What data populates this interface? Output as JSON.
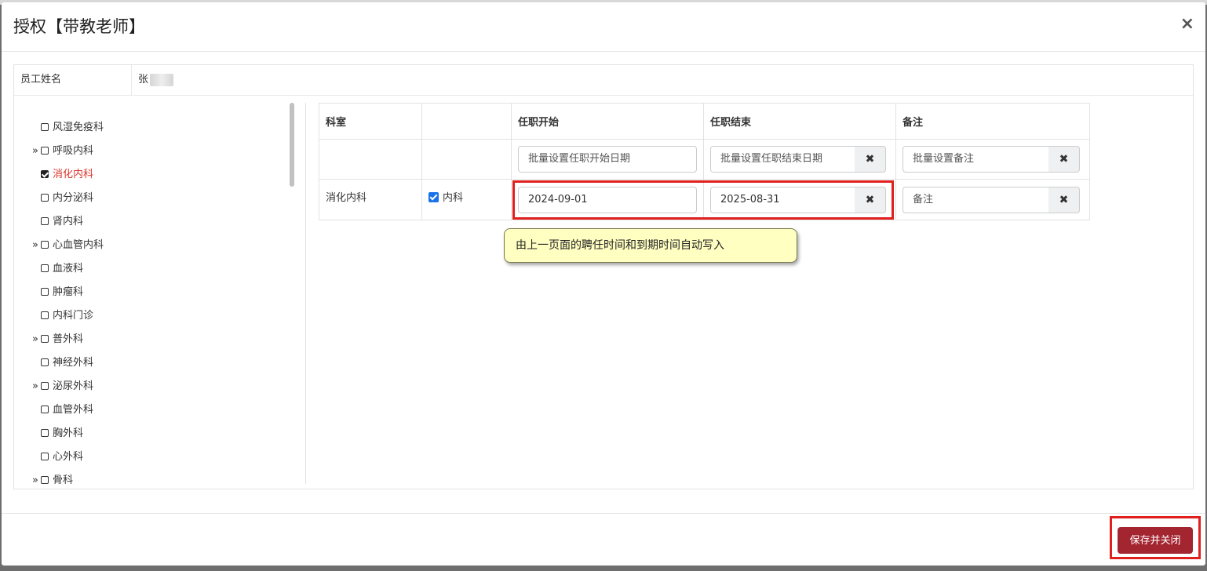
{
  "modal": {
    "title": "授权【带教老师】",
    "close_label": "×"
  },
  "employee": {
    "label": "员工姓名",
    "name_visible": "张"
  },
  "tree": {
    "items": [
      {
        "label": "风湿免疫科",
        "expandable": false,
        "checked": false,
        "active": false
      },
      {
        "label": "呼吸内科",
        "expandable": true,
        "checked": false,
        "active": false
      },
      {
        "label": "消化内科",
        "expandable": false,
        "checked": true,
        "active": true
      },
      {
        "label": "内分泌科",
        "expandable": false,
        "checked": false,
        "active": false
      },
      {
        "label": "肾内科",
        "expandable": false,
        "checked": false,
        "active": false
      },
      {
        "label": "心血管内科",
        "expandable": true,
        "checked": false,
        "active": false
      },
      {
        "label": "血液科",
        "expandable": false,
        "checked": false,
        "active": false
      },
      {
        "label": "肿瘤科",
        "expandable": false,
        "checked": false,
        "active": false
      },
      {
        "label": "内科门诊",
        "expandable": false,
        "checked": false,
        "active": false
      },
      {
        "label": "普外科",
        "expandable": true,
        "checked": false,
        "active": false
      },
      {
        "label": "神经外科",
        "expandable": false,
        "checked": false,
        "active": false
      },
      {
        "label": "泌尿外科",
        "expandable": true,
        "checked": false,
        "active": false
      },
      {
        "label": "血管外科",
        "expandable": false,
        "checked": false,
        "active": false
      },
      {
        "label": "胸外科",
        "expandable": false,
        "checked": false,
        "active": false
      },
      {
        "label": "心外科",
        "expandable": false,
        "checked": false,
        "active": false
      },
      {
        "label": "骨科",
        "expandable": true,
        "checked": false,
        "active": false
      }
    ]
  },
  "table": {
    "headers": [
      "科室",
      "",
      "任职开始",
      "任职结束",
      "备注"
    ],
    "batch": {
      "start_placeholder": "批量设置任职开始日期",
      "end_placeholder": "批量设置任职结束日期",
      "remark_placeholder": "批量设置备注",
      "clear_glyph": "✖"
    },
    "rows": [
      {
        "department": "消化内科",
        "parent_label": "内科",
        "start": "2024-09-01",
        "end": "2025-08-31",
        "remark_placeholder": "备注"
      }
    ]
  },
  "annotation": {
    "tooltip": "由上一页面的聘任时间和到期时间自动写入"
  },
  "footer": {
    "save_label": "保存并关闭"
  },
  "colors": {
    "active_item": "#d9362b",
    "save_button": "#a32530",
    "highlight": "#e01f1f",
    "tooltip_bg": "#ffffc2"
  }
}
